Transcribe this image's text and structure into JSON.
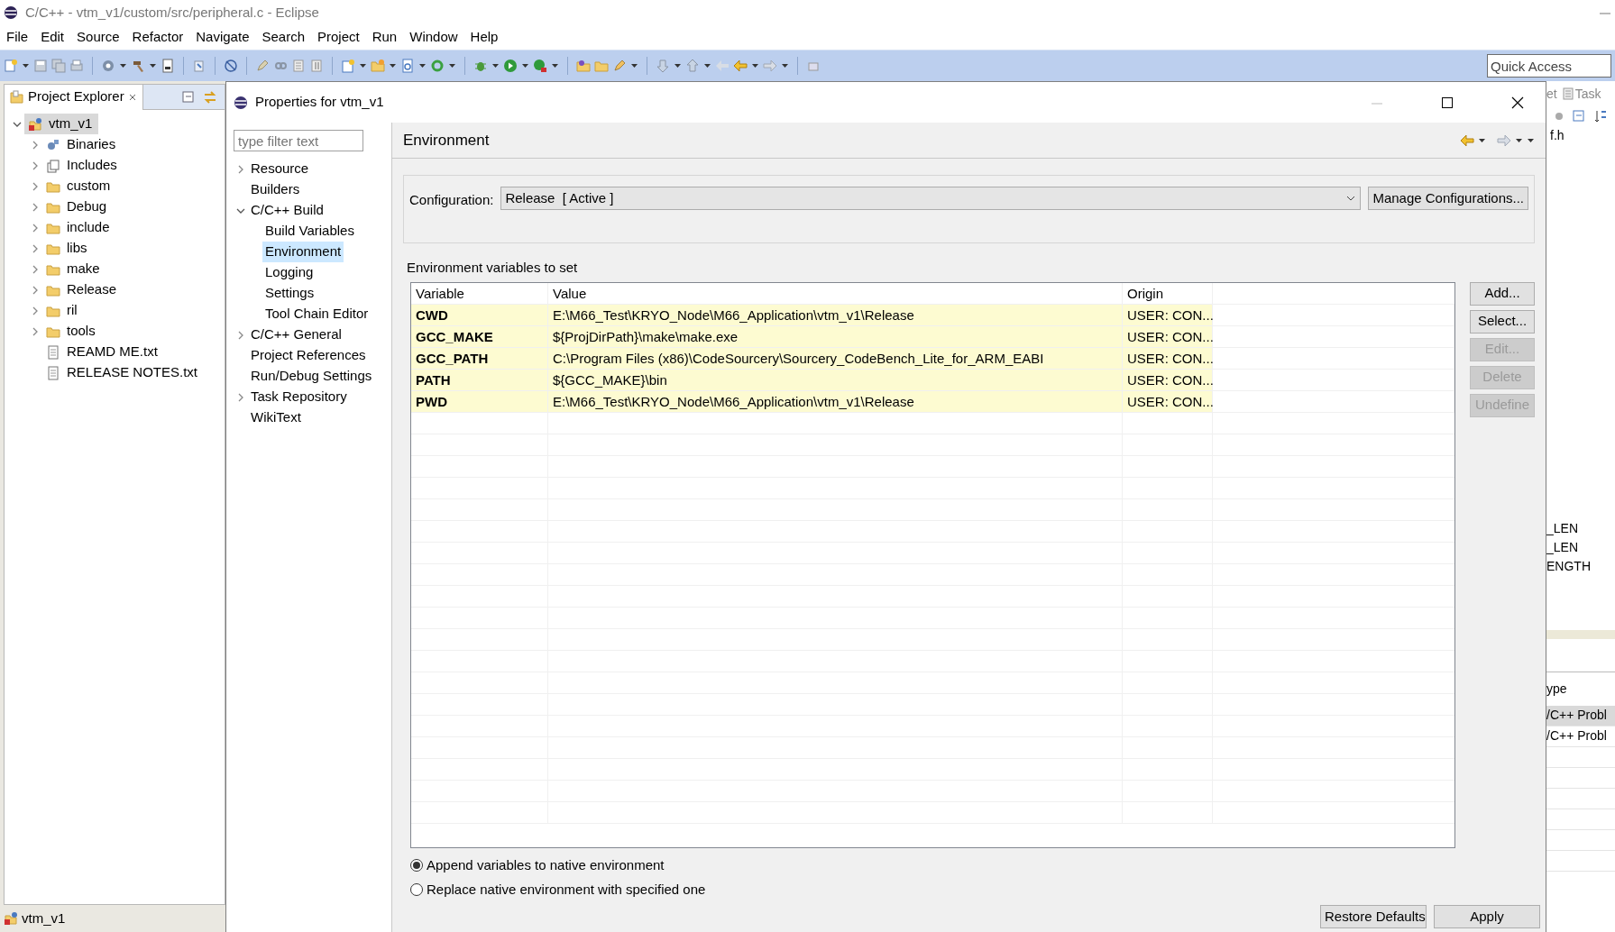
{
  "window": {
    "title": "C/C++ - vtm_v1/custom/src/peripheral.c - Eclipse"
  },
  "menu": [
    "File",
    "Edit",
    "Source",
    "Refactor",
    "Navigate",
    "Search",
    "Project",
    "Run",
    "Window",
    "Help"
  ],
  "quick_access": {
    "placeholder": "Quick Access"
  },
  "project_explorer": {
    "title": "Project Explorer",
    "items": [
      {
        "label": "vtm_v1",
        "kind": "project",
        "expanded": true,
        "selected": true,
        "children": [
          {
            "label": "Binaries",
            "kind": "binaries",
            "expanded": false,
            "selected": false
          },
          {
            "label": "Includes",
            "kind": "includes",
            "expanded": false,
            "selected": false
          },
          {
            "label": "custom",
            "kind": "folder",
            "expanded": false,
            "selected": false
          },
          {
            "label": "Debug",
            "kind": "folder",
            "expanded": false,
            "selected": false
          },
          {
            "label": "include",
            "kind": "folder",
            "expanded": false,
            "selected": false
          },
          {
            "label": "libs",
            "kind": "folder",
            "expanded": false,
            "selected": false
          },
          {
            "label": "make",
            "kind": "folder",
            "expanded": false,
            "selected": false
          },
          {
            "label": "Release",
            "kind": "folder",
            "expanded": false,
            "selected": false
          },
          {
            "label": "ril",
            "kind": "folder",
            "expanded": false,
            "selected": false
          },
          {
            "label": "tools",
            "kind": "folder",
            "expanded": false,
            "selected": false
          },
          {
            "label": "REAMD ME.txt",
            "kind": "file",
            "selected": false
          },
          {
            "label": "RELEASE NOTES.txt",
            "kind": "file",
            "selected": false
          }
        ]
      }
    ]
  },
  "status_bar": {
    "text": "vtm_v1"
  },
  "dialog": {
    "title": "Properties for vtm_v1",
    "filter": {
      "placeholder": "type filter text"
    },
    "tree": [
      {
        "label": "Resource",
        "expanded": false,
        "selected": false
      },
      {
        "label": "Builders",
        "selected": false
      },
      {
        "label": "C/C++ Build",
        "expanded": true,
        "selected": false,
        "children": [
          {
            "label": "Build Variables",
            "selected": false
          },
          {
            "label": "Environment",
            "selected": true
          },
          {
            "label": "Logging",
            "selected": false
          },
          {
            "label": "Settings",
            "selected": false
          },
          {
            "label": "Tool Chain Editor",
            "selected": false
          }
        ]
      },
      {
        "label": "C/C++ General",
        "expanded": false,
        "selected": false
      },
      {
        "label": "Project References",
        "selected": false
      },
      {
        "label": "Run/Debug Settings",
        "selected": false
      },
      {
        "label": "Task Repository",
        "expanded": false,
        "selected": false
      },
      {
        "label": "WikiText",
        "selected": false
      }
    ],
    "page": {
      "title": "Environment",
      "configuration": {
        "label": "Configuration:",
        "value": "Release  [ Active ]"
      },
      "manage_button": "Manage Configurations...",
      "table_title": "Environment variables to set",
      "columns": [
        "Variable",
        "Value",
        "Origin"
      ],
      "rows": [
        {
          "variable": "CWD",
          "value": "E:\\M66_Test\\KRYO_Node\\M66_Application\\vtm_v1\\Release",
          "origin": "USER: CON..."
        },
        {
          "variable": "GCC_MAKE",
          "value": "${ProjDirPath}\\make\\make.exe",
          "origin": "USER: CON..."
        },
        {
          "variable": "GCC_PATH",
          "value": "C:\\Program Files (x86)\\CodeSourcery\\Sourcery_CodeBench_Lite_for_ARM_EABI",
          "origin": "USER: CON..."
        },
        {
          "variable": "PATH",
          "value": "${GCC_MAKE}\\bin",
          "origin": "USER: CON..."
        },
        {
          "variable": "PWD",
          "value": "E:\\M66_Test\\KRYO_Node\\M66_Application\\vtm_v1\\Release",
          "origin": "USER: CON..."
        }
      ],
      "side_buttons": [
        {
          "label": "Add...",
          "disabled": false
        },
        {
          "label": "Select...",
          "disabled": false
        },
        {
          "label": "Edit...",
          "disabled": true
        },
        {
          "label": "Delete",
          "disabled": true
        },
        {
          "label": "Undefine",
          "disabled": true
        }
      ],
      "radios": [
        {
          "label": "Append variables to native environment",
          "selected": true
        },
        {
          "label": "Replace native environment with specified one",
          "selected": false
        }
      ],
      "footer_buttons": [
        "Restore Defaults",
        "Apply"
      ]
    }
  },
  "background_view": {
    "tabs": [
      "et",
      "Task"
    ],
    "texts": [
      "f.h",
      "_LEN",
      "_LEN",
      "ENGTH"
    ],
    "column": "ype",
    "rows": [
      {
        "text": "/C++ Probl",
        "selected": true
      },
      {
        "text": "/C++ Probl",
        "selected": false
      }
    ]
  }
}
